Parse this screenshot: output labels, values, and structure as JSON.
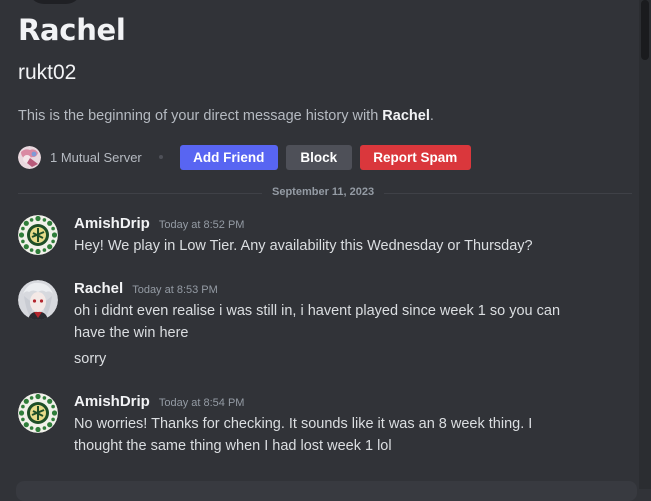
{
  "profile": {
    "display_name": "Rachel",
    "username": "rukt02",
    "intro_prefix": "This is the beginning of your direct message history with ",
    "intro_name": "Rachel",
    "intro_suffix": "."
  },
  "mutual": {
    "label": "1 Mutual Server"
  },
  "buttons": {
    "add_friend": "Add Friend",
    "block": "Block",
    "report_spam": "Report Spam"
  },
  "date_divider": "September 11, 2023",
  "messages": [
    {
      "author": "AmishDrip",
      "timestamp": "Today at 8:52 PM",
      "lines": [
        "Hey! We play in Low Tier. Any availability this Wednesday or Thursday?"
      ]
    },
    {
      "author": "Rachel",
      "timestamp": "Today at 8:53 PM",
      "lines": [
        "oh i didnt even realise i was still in, i havent played since week 1 so you can",
        "have the win here",
        "sorry"
      ]
    },
    {
      "author": "AmishDrip",
      "timestamp": "Today at 8:54 PM",
      "lines": [
        "No worries! Thanks for checking. It sounds like it was an 8 week thing. I",
        "thought the same thing when I had lost week 1 lol"
      ]
    }
  ],
  "colors": {
    "background": "#313338",
    "blurple": "#5865f2",
    "danger": "#da373c",
    "neutral_button": "#4e5058"
  }
}
